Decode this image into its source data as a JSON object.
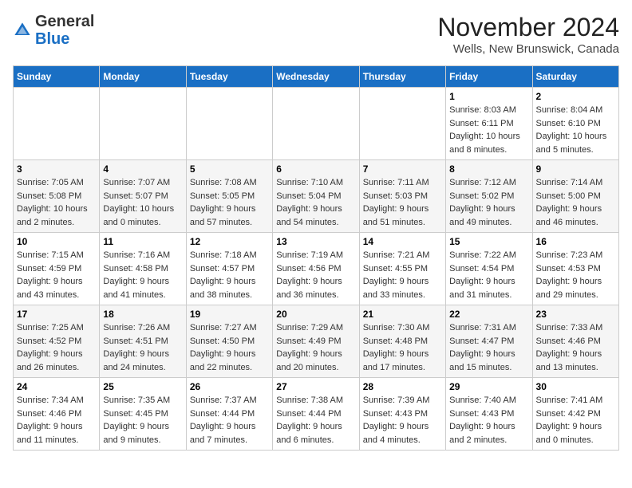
{
  "header": {
    "logo_general": "General",
    "logo_blue": "Blue",
    "month_title": "November 2024",
    "location": "Wells, New Brunswick, Canada"
  },
  "weekdays": [
    "Sunday",
    "Monday",
    "Tuesday",
    "Wednesday",
    "Thursday",
    "Friday",
    "Saturday"
  ],
  "weeks": [
    [
      {
        "day": "",
        "info": ""
      },
      {
        "day": "",
        "info": ""
      },
      {
        "day": "",
        "info": ""
      },
      {
        "day": "",
        "info": ""
      },
      {
        "day": "",
        "info": ""
      },
      {
        "day": "1",
        "info": "Sunrise: 8:03 AM\nSunset: 6:11 PM\nDaylight: 10 hours and 8 minutes."
      },
      {
        "day": "2",
        "info": "Sunrise: 8:04 AM\nSunset: 6:10 PM\nDaylight: 10 hours and 5 minutes."
      }
    ],
    [
      {
        "day": "3",
        "info": "Sunrise: 7:05 AM\nSunset: 5:08 PM\nDaylight: 10 hours and 2 minutes."
      },
      {
        "day": "4",
        "info": "Sunrise: 7:07 AM\nSunset: 5:07 PM\nDaylight: 10 hours and 0 minutes."
      },
      {
        "day": "5",
        "info": "Sunrise: 7:08 AM\nSunset: 5:05 PM\nDaylight: 9 hours and 57 minutes."
      },
      {
        "day": "6",
        "info": "Sunrise: 7:10 AM\nSunset: 5:04 PM\nDaylight: 9 hours and 54 minutes."
      },
      {
        "day": "7",
        "info": "Sunrise: 7:11 AM\nSunset: 5:03 PM\nDaylight: 9 hours and 51 minutes."
      },
      {
        "day": "8",
        "info": "Sunrise: 7:12 AM\nSunset: 5:02 PM\nDaylight: 9 hours and 49 minutes."
      },
      {
        "day": "9",
        "info": "Sunrise: 7:14 AM\nSunset: 5:00 PM\nDaylight: 9 hours and 46 minutes."
      }
    ],
    [
      {
        "day": "10",
        "info": "Sunrise: 7:15 AM\nSunset: 4:59 PM\nDaylight: 9 hours and 43 minutes."
      },
      {
        "day": "11",
        "info": "Sunrise: 7:16 AM\nSunset: 4:58 PM\nDaylight: 9 hours and 41 minutes."
      },
      {
        "day": "12",
        "info": "Sunrise: 7:18 AM\nSunset: 4:57 PM\nDaylight: 9 hours and 38 minutes."
      },
      {
        "day": "13",
        "info": "Sunrise: 7:19 AM\nSunset: 4:56 PM\nDaylight: 9 hours and 36 minutes."
      },
      {
        "day": "14",
        "info": "Sunrise: 7:21 AM\nSunset: 4:55 PM\nDaylight: 9 hours and 33 minutes."
      },
      {
        "day": "15",
        "info": "Sunrise: 7:22 AM\nSunset: 4:54 PM\nDaylight: 9 hours and 31 minutes."
      },
      {
        "day": "16",
        "info": "Sunrise: 7:23 AM\nSunset: 4:53 PM\nDaylight: 9 hours and 29 minutes."
      }
    ],
    [
      {
        "day": "17",
        "info": "Sunrise: 7:25 AM\nSunset: 4:52 PM\nDaylight: 9 hours and 26 minutes."
      },
      {
        "day": "18",
        "info": "Sunrise: 7:26 AM\nSunset: 4:51 PM\nDaylight: 9 hours and 24 minutes."
      },
      {
        "day": "19",
        "info": "Sunrise: 7:27 AM\nSunset: 4:50 PM\nDaylight: 9 hours and 22 minutes."
      },
      {
        "day": "20",
        "info": "Sunrise: 7:29 AM\nSunset: 4:49 PM\nDaylight: 9 hours and 20 minutes."
      },
      {
        "day": "21",
        "info": "Sunrise: 7:30 AM\nSunset: 4:48 PM\nDaylight: 9 hours and 17 minutes."
      },
      {
        "day": "22",
        "info": "Sunrise: 7:31 AM\nSunset: 4:47 PM\nDaylight: 9 hours and 15 minutes."
      },
      {
        "day": "23",
        "info": "Sunrise: 7:33 AM\nSunset: 4:46 PM\nDaylight: 9 hours and 13 minutes."
      }
    ],
    [
      {
        "day": "24",
        "info": "Sunrise: 7:34 AM\nSunset: 4:46 PM\nDaylight: 9 hours and 11 minutes."
      },
      {
        "day": "25",
        "info": "Sunrise: 7:35 AM\nSunset: 4:45 PM\nDaylight: 9 hours and 9 minutes."
      },
      {
        "day": "26",
        "info": "Sunrise: 7:37 AM\nSunset: 4:44 PM\nDaylight: 9 hours and 7 minutes."
      },
      {
        "day": "27",
        "info": "Sunrise: 7:38 AM\nSunset: 4:44 PM\nDaylight: 9 hours and 6 minutes."
      },
      {
        "day": "28",
        "info": "Sunrise: 7:39 AM\nSunset: 4:43 PM\nDaylight: 9 hours and 4 minutes."
      },
      {
        "day": "29",
        "info": "Sunrise: 7:40 AM\nSunset: 4:43 PM\nDaylight: 9 hours and 2 minutes."
      },
      {
        "day": "30",
        "info": "Sunrise: 7:41 AM\nSunset: 4:42 PM\nDaylight: 9 hours and 0 minutes."
      }
    ]
  ]
}
